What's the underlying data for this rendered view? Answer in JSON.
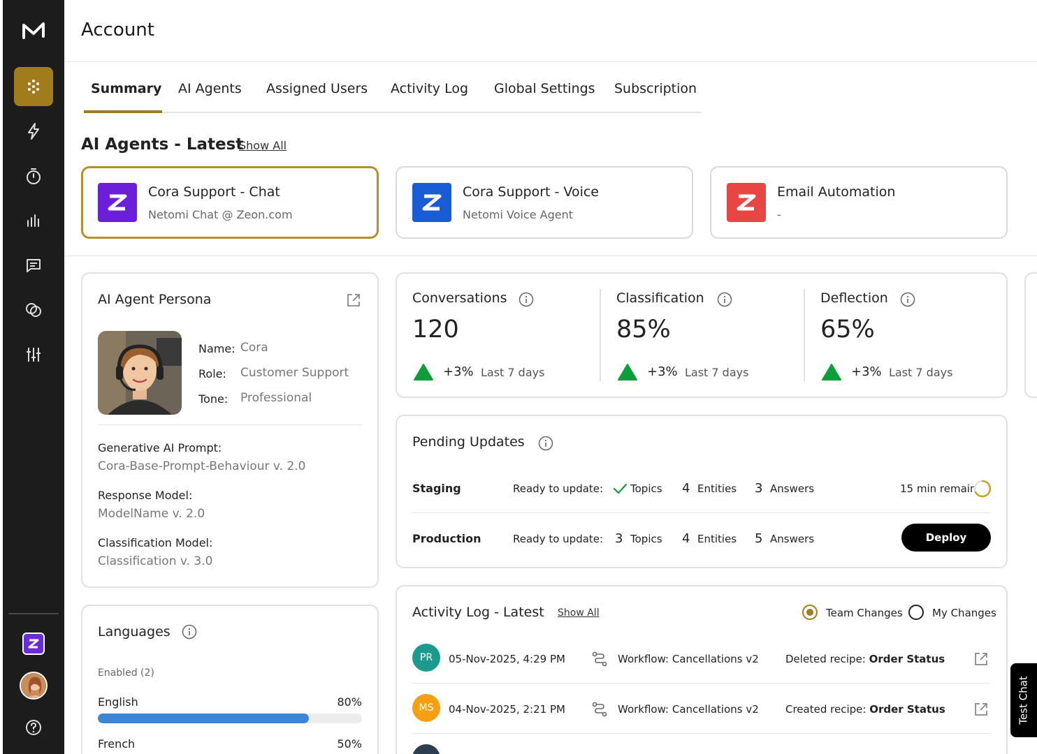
{
  "header": {
    "title": "Account"
  },
  "tabs": [
    {
      "label": "Summary",
      "active": true
    },
    {
      "label": "AI Agents"
    },
    {
      "label": "Assigned Users"
    },
    {
      "label": "Activity Log"
    },
    {
      "label": "Global Settings"
    },
    {
      "label": "Subscription"
    }
  ],
  "agents_latest": {
    "title": "AI Agents - Latest",
    "show_all": "Show All",
    "cards": [
      {
        "name": "Cora Support - Chat",
        "sub": "Netomi Chat @ Zeon.com",
        "color": "#6b1fd8",
        "selected": true
      },
      {
        "name": "Cora Support - Voice",
        "sub": "Netomi Voice Agent",
        "color": "#1a5bd6"
      },
      {
        "name": "Email Automation",
        "sub": "-",
        "color": "#e84545"
      }
    ]
  },
  "persona": {
    "title": "AI Agent Persona",
    "name_label": "Name:",
    "name": "Cora",
    "role_label": "Role:",
    "role": "Customer Support",
    "tone_label": "Tone:",
    "tone": "Professional",
    "prompt_label": "Generative AI Prompt:",
    "prompt": "Cora-Base-Prompt-Behaviour v. 2.0",
    "response_label": "Response Model:",
    "response": "ModelName v. 2.0",
    "classification_label": "Classification Model:",
    "classification": "Classification v. 3.0"
  },
  "metrics": [
    {
      "label": "Conversations",
      "value": "120",
      "change": "+3%",
      "period": "Last 7 days"
    },
    {
      "label": "Classification",
      "value": "85%",
      "change": "+3%",
      "period": "Last 7 days"
    },
    {
      "label": "Deflection",
      "value": "65%",
      "change": "+3%",
      "period": "Last 7 days"
    }
  ],
  "pending": {
    "title": "Pending Updates",
    "staging": {
      "env": "Staging",
      "ready": "Ready to update:",
      "topics_label": "Topics",
      "entities_num": "4",
      "entities_label": "Entities",
      "answers_num": "3",
      "answers_label": "Answers",
      "remain": "15 min remain"
    },
    "production": {
      "env": "Production",
      "ready": "Ready to update:",
      "topics_num": "3",
      "topics_label": "Topics",
      "entities_num": "4",
      "entities_label": "Entities",
      "answers_num": "5",
      "answers_label": "Answers",
      "deploy": "Deploy"
    }
  },
  "activity": {
    "title": "Activity Log - Latest",
    "show_all": "Show All",
    "team": "Team Changes",
    "mine": "My Changes",
    "rows": [
      {
        "initials": "PR",
        "color": "#1a9b8e",
        "date": "05-Nov-2025, 4:29 PM",
        "workflow": "Workflow: Cancellations v2",
        "action": "Deleted recipe:",
        "target": "Order Status"
      },
      {
        "initials": "MS",
        "color": "#f5a012",
        "date": "04-Nov-2025, 2:21 PM",
        "workflow": "Workflow: Cancellations v2",
        "action": "Created recipe:",
        "target": "Order Status"
      }
    ]
  },
  "languages": {
    "title": "Languages",
    "enabled": "Enabled (2)",
    "items": [
      {
        "name": "English",
        "pct": "80%",
        "fill": 0.8
      },
      {
        "name": "French",
        "pct": "50%",
        "fill": 0.5
      }
    ]
  },
  "test_chat": "Test Chat"
}
